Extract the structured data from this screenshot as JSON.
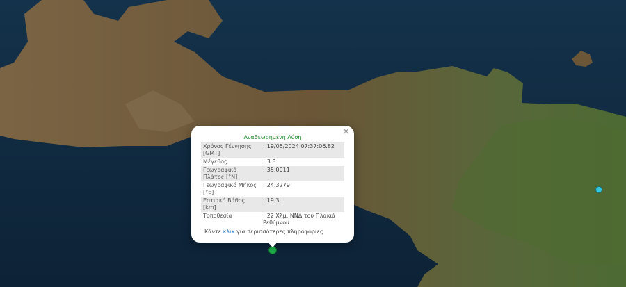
{
  "popup": {
    "heading": "Αναθεωρημένη Λύση",
    "close": "×",
    "rows": [
      {
        "label": "Χρόνος Γέννησης [GMT]",
        "value": "19/05/2024 07:37:06.82"
      },
      {
        "label": "Μέγεθος",
        "value": "3.8"
      },
      {
        "label": "Γεωγραφικό Πλάτος [°N]",
        "value": "35.0011"
      },
      {
        "label": "Γεωγραφικό Μήκος [°E]",
        "value": "24.3279"
      },
      {
        "label": "Εστιακό Βάθος [km]",
        "value": "19.3"
      },
      {
        "label": "Τοποθεσία",
        "value": "22 Χλμ. ΝΝΔ του Πλακιά Ρεθύμνου"
      }
    ],
    "more_prefix": "Κάντε",
    "more_link": "κλικ",
    "more_suffix": "για περισσότερες πληροφορίες"
  },
  "colors": {
    "sea": "#0f2a40",
    "land": "#6e5a3d",
    "vegetation": "#4f6b32",
    "marker_selected": "#1fae4a",
    "marker_other": "#33c8e0",
    "heading": "#1e8a2e",
    "link": "#1a73c8"
  },
  "markers": [
    {
      "name": "selected-earthquake",
      "color": "#1fae4a"
    },
    {
      "name": "other-earthquake",
      "color": "#33c8e0"
    }
  ]
}
